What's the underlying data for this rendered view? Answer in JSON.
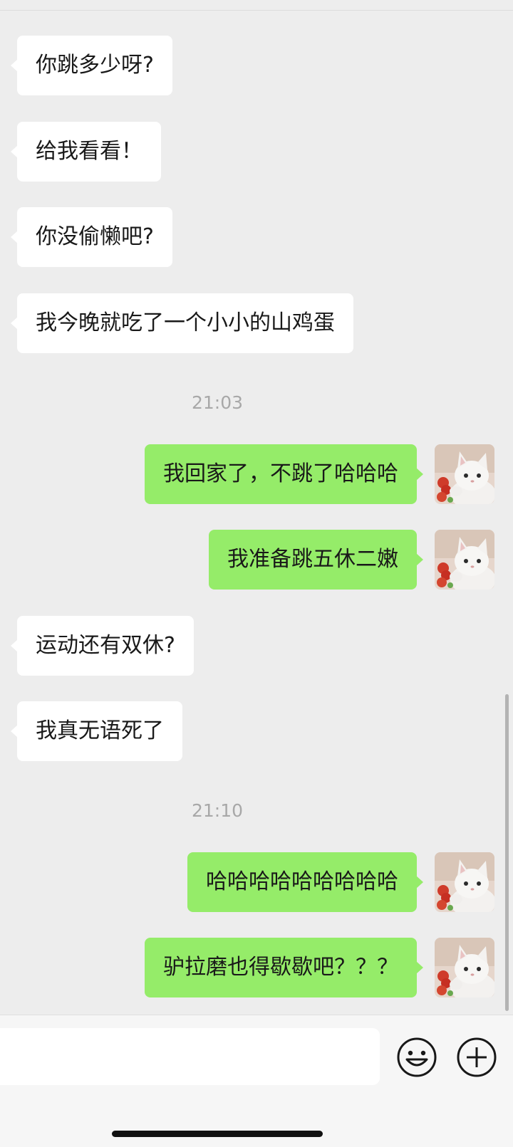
{
  "messages": [
    {
      "side": "in",
      "text": "你跳多少呀?"
    },
    {
      "side": "in",
      "text": "给我看看！"
    },
    {
      "side": "in",
      "text": "你没偷懒吧?"
    },
    {
      "side": "in",
      "text": "我今晚就吃了一个小小的山鸡蛋"
    },
    {
      "side": "out",
      "text": "我回家了，不跳了哈哈哈"
    },
    {
      "side": "out",
      "text": "我准备跳五休二嫩"
    },
    {
      "side": "in",
      "text": "运动还有双休?"
    },
    {
      "side": "in",
      "text": "我真无语死了"
    },
    {
      "side": "out",
      "text": "哈哈哈哈哈哈哈哈哈"
    },
    {
      "side": "out",
      "text": "驴拉磨也得歇歇吧？？？"
    }
  ],
  "timestamps": [
    "21:03",
    "21:10"
  ],
  "avatar": {
    "icon": "white-cat-avatar"
  },
  "input_bar": {
    "emoji_icon": "smiley-icon",
    "plus_icon": "plus-circle-icon"
  },
  "colors": {
    "background": "#ededed",
    "incoming_bubble": "#ffffff",
    "outgoing_bubble": "#95ec69"
  }
}
